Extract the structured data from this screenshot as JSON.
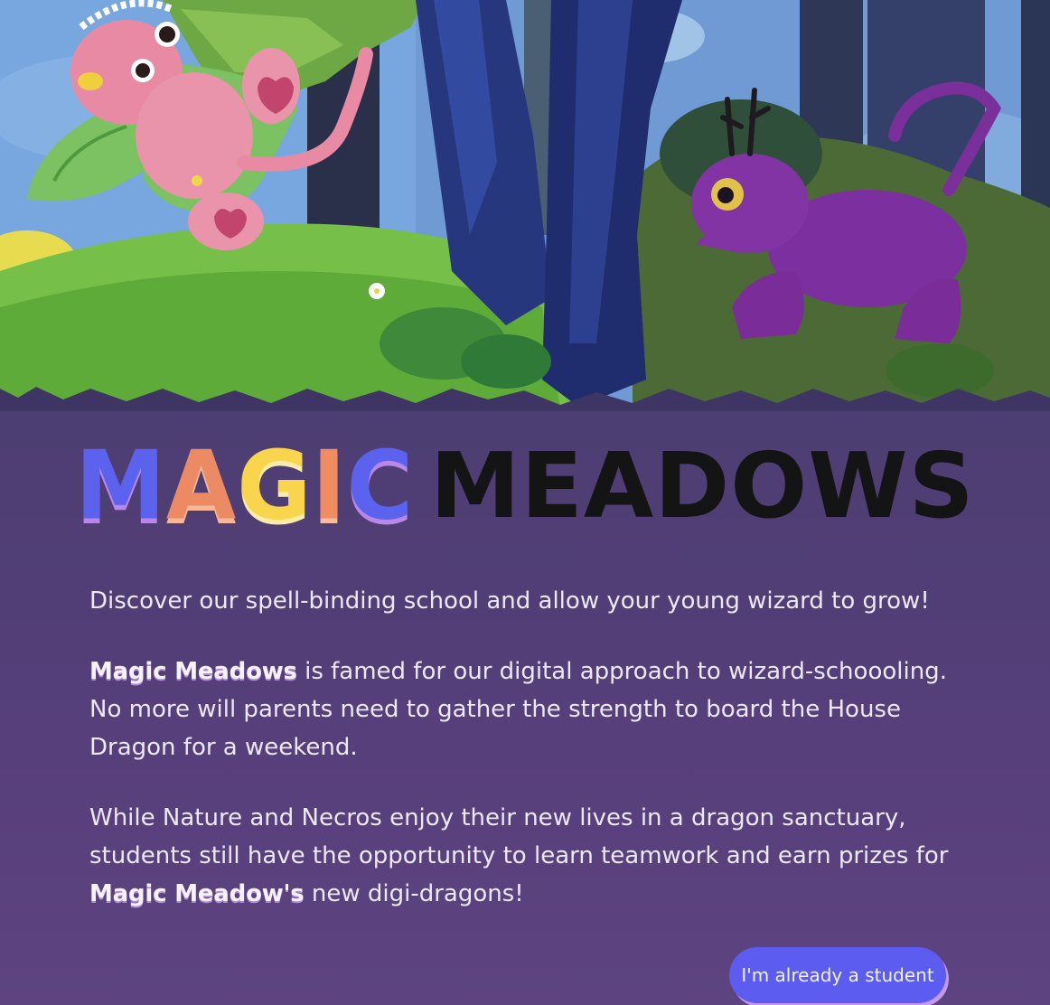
{
  "hero": {
    "illustration": "forest-meadow-with-pink-and-purple-dragons"
  },
  "title": {
    "word1_letters": [
      "M",
      "A",
      "G",
      "I",
      "C"
    ],
    "word2": "MEADOWS",
    "colors": {
      "blue": "#5b63ee",
      "orange": "#ec8a63",
      "yellow": "#f9d54d",
      "dark": "#141414"
    }
  },
  "content": {
    "intro": "Discover our spell-binding school and allow your young wizard to grow!",
    "p2_brand": "Magic Meadows",
    "p2_text": " is famed for our digital approach to wizard-schoooling. No more will parents need to gather the strength to board the House Dragon for a weekend.",
    "p3_text_before": "While Nature and Necros enjoy their new lives in a dragon sanctuary, students still have the opportunity to learn teamwork and earn prizes for ",
    "p3_brand": "Magic Meadow's",
    "p3_text_after": " new digi-dragons!"
  },
  "actions": {
    "student_button_label": "I'm already a student"
  },
  "theme": {
    "background_top": "#3f3565",
    "background_bottom": "#5d4480",
    "button_color": "#5c5df0",
    "button_shadow": "#c697ec"
  }
}
